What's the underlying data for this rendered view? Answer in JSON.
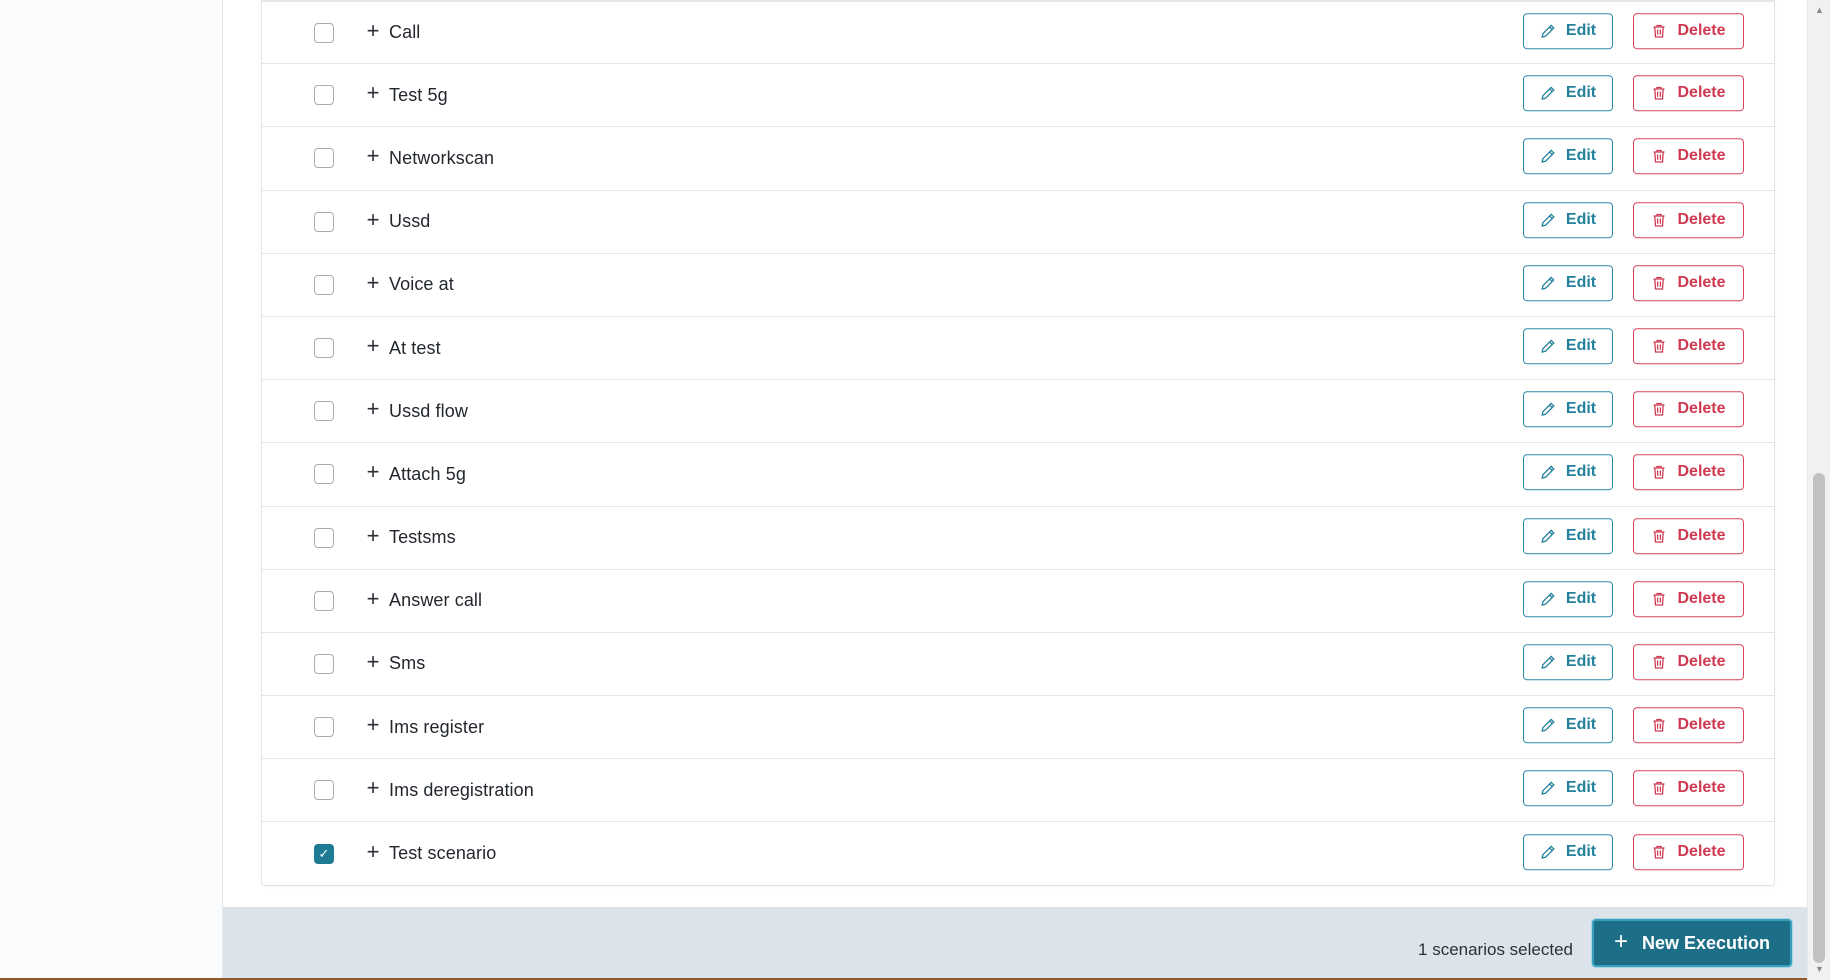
{
  "scenarios": [
    {
      "name": "Call",
      "checked": false
    },
    {
      "name": "Test 5g",
      "checked": false
    },
    {
      "name": "Networkscan",
      "checked": false
    },
    {
      "name": "Ussd",
      "checked": false
    },
    {
      "name": "Voice at",
      "checked": false
    },
    {
      "name": "At test",
      "checked": false
    },
    {
      "name": "Ussd flow",
      "checked": false
    },
    {
      "name": "Attach 5g",
      "checked": false
    },
    {
      "name": "Testsms",
      "checked": false
    },
    {
      "name": "Answer call",
      "checked": false
    },
    {
      "name": "Sms",
      "checked": false
    },
    {
      "name": "Ims register",
      "checked": false
    },
    {
      "name": "Ims deregistration",
      "checked": false
    },
    {
      "name": "Test scenario",
      "checked": true
    }
  ],
  "row_actions": {
    "edit_label": "Edit",
    "delete_label": "Delete",
    "expand_glyph": "+"
  },
  "footer": {
    "selected_text": "1 scenarios selected",
    "new_execution_label": "New Execution",
    "new_execution_icon": "+"
  },
  "colors": {
    "accent": "#1c6f86",
    "edit": "#23819c",
    "delete": "#cf3a51",
    "footer_bg": "#dde3ea"
  },
  "icons": {
    "edit": "pencil-icon",
    "delete": "trash-icon",
    "expand": "plus-icon",
    "checked": "checkmark-icon"
  }
}
